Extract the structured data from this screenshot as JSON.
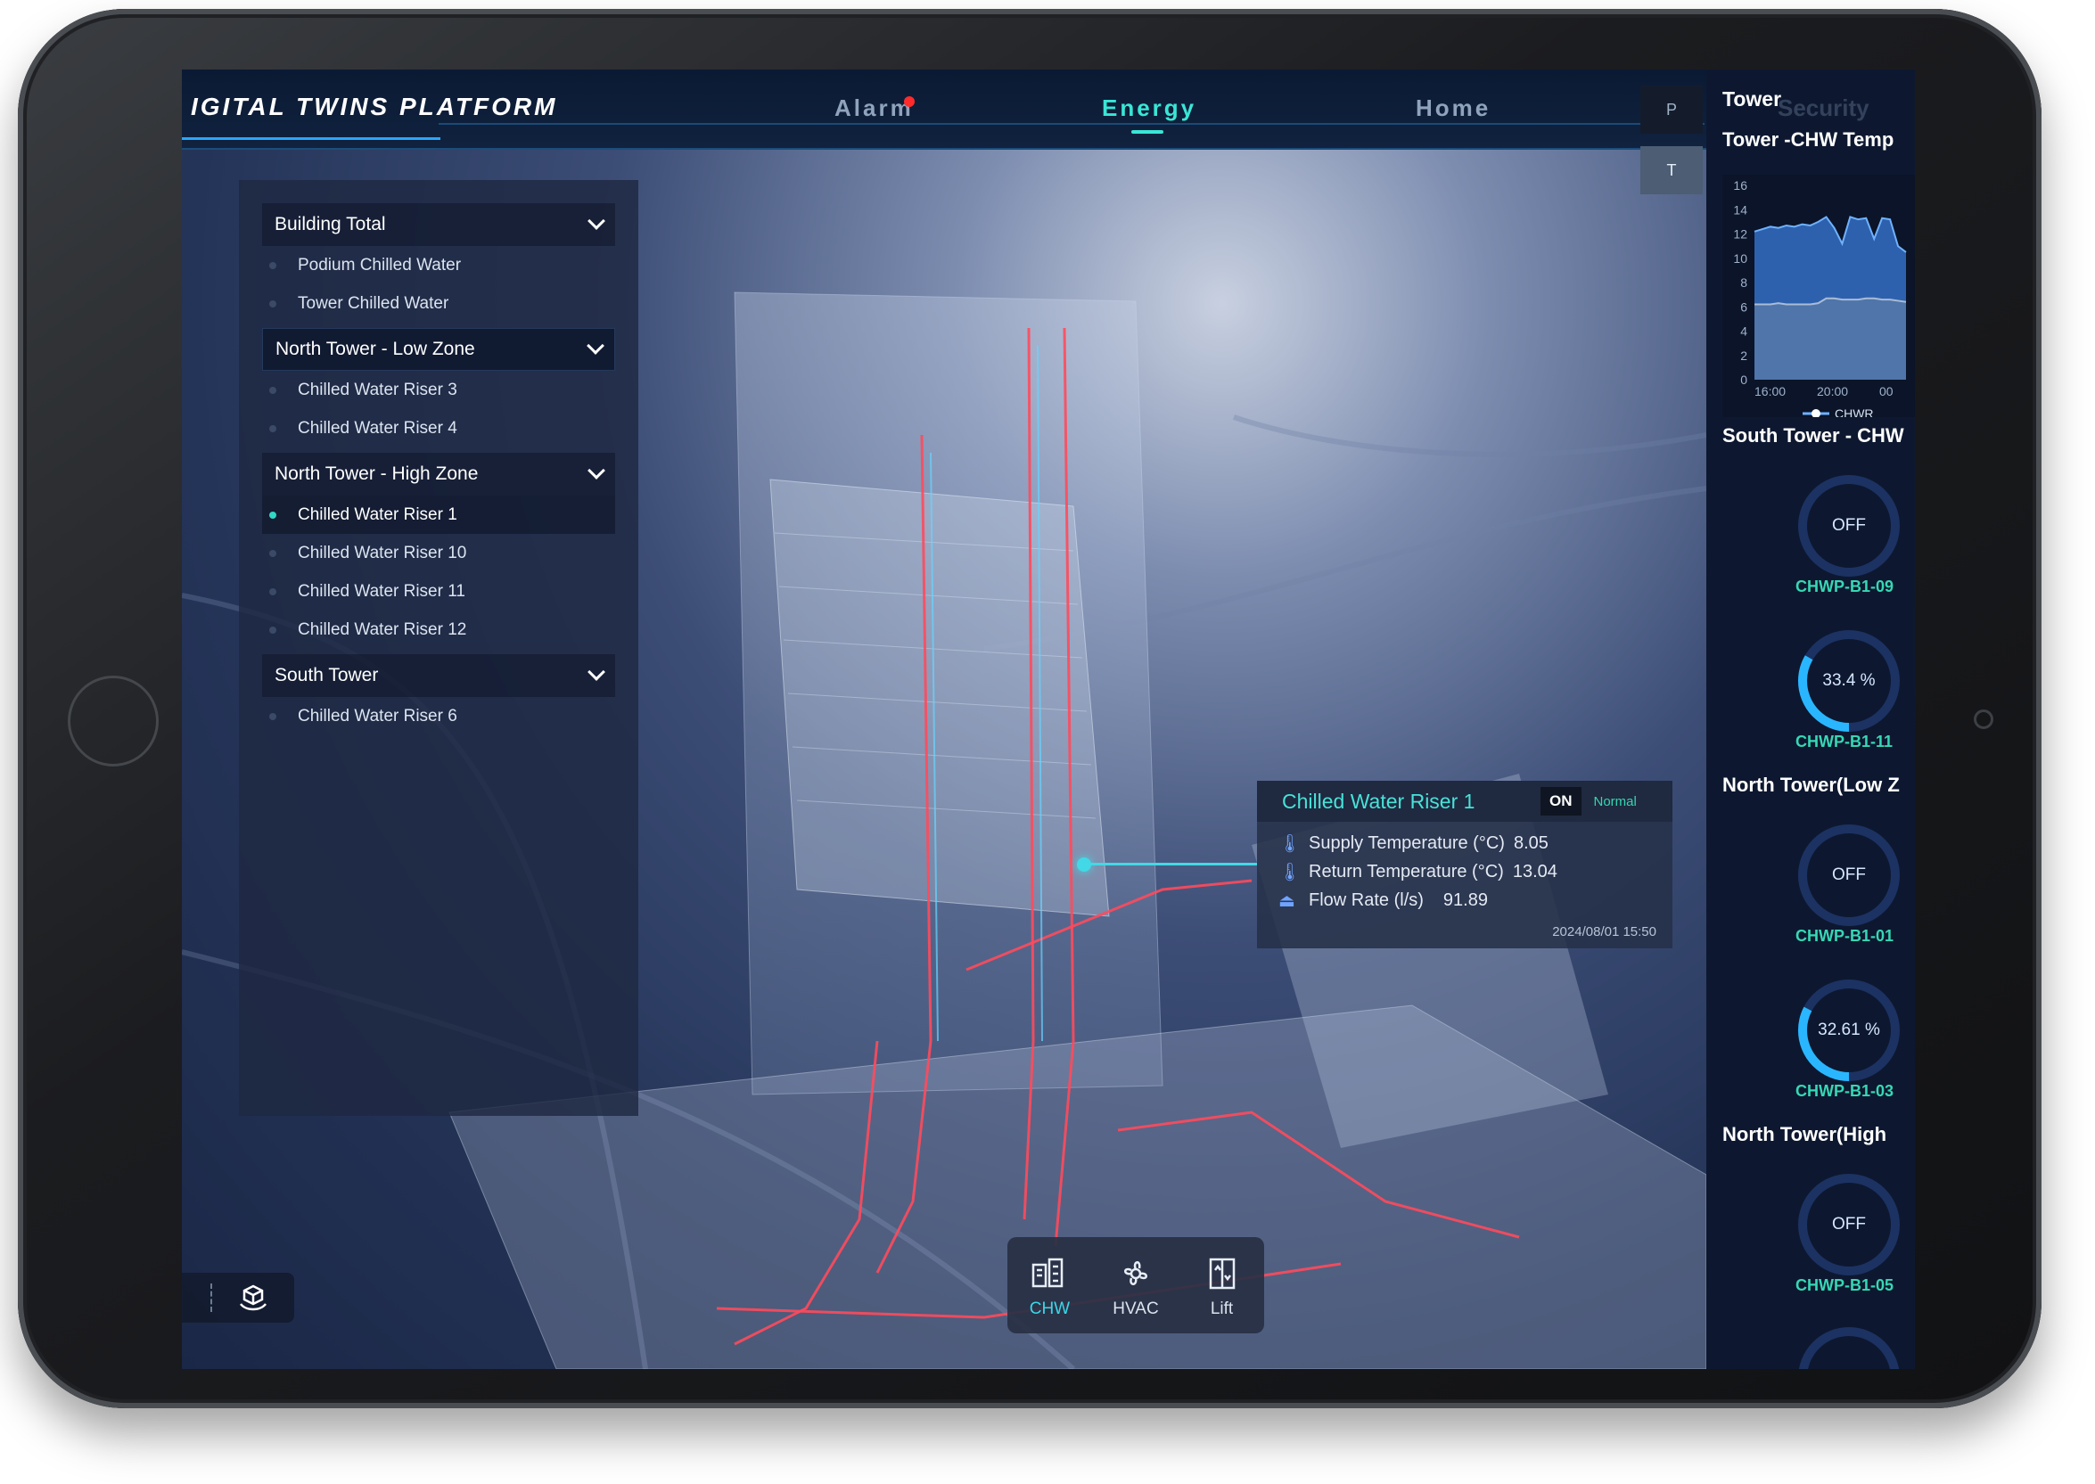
{
  "header": {
    "brand": "IGITAL TWINS PLATFORM",
    "nav": [
      {
        "label": "Alarm",
        "active": false
      },
      {
        "label": "Energy",
        "active": true
      },
      {
        "label": "Home",
        "active": false
      }
    ],
    "side_tabs": [
      "P",
      "T"
    ]
  },
  "tree": {
    "groups": [
      {
        "label": "Building Total",
        "items": [
          {
            "label": "Podium Chilled Water",
            "active": false
          },
          {
            "label": "Tower Chilled Water",
            "active": false
          }
        ]
      },
      {
        "label": "North Tower - Low Zone",
        "items": [
          {
            "label": "Chilled Water Riser 3",
            "active": false
          },
          {
            "label": "Chilled Water Riser 4",
            "active": false
          }
        ]
      },
      {
        "label": "North Tower - High Zone",
        "items": [
          {
            "label": "Chilled Water Riser 1",
            "active": true
          },
          {
            "label": "Chilled Water Riser 10",
            "active": false
          },
          {
            "label": "Chilled Water Riser 11",
            "active": false
          },
          {
            "label": "Chilled Water Riser 12",
            "active": false
          }
        ]
      },
      {
        "label": "South Tower",
        "items": [
          {
            "label": "Chilled Water Riser 6",
            "active": false
          }
        ]
      }
    ]
  },
  "popup": {
    "title": "Chilled Water Riser 1",
    "state": "ON",
    "status": "Normal",
    "rows": [
      {
        "icon": "thermometer-icon",
        "label": "Supply Temperature (°C)",
        "value": "8.05"
      },
      {
        "icon": "thermometer-icon",
        "label": "Return Temperature (°C)",
        "value": "13.04"
      },
      {
        "icon": "flow-icon",
        "label": "Flow Rate (l/s)",
        "value": "91.89"
      }
    ],
    "timestamp": "2024/08/01 15:50"
  },
  "toolbar": {
    "tools": [
      {
        "label": "CHW",
        "icon": "building-icon",
        "active": true
      },
      {
        "label": "HVAC",
        "icon": "fan-icon",
        "active": false
      },
      {
        "label": "Lift",
        "icon": "lift-icon",
        "active": false
      }
    ]
  },
  "right_panel": {
    "title": "Tower",
    "ghost_text": "Security",
    "chart_title": "Tower -CHW Temp",
    "sections": [
      {
        "title": "South Tower - CHW",
        "gauges": [
          {
            "label": "CHWP-B1-09",
            "text": "OFF",
            "percent": 0
          },
          {
            "label": "CHWP-B1-11",
            "text": "33.4 %",
            "percent": 33.4
          }
        ]
      },
      {
        "title": "North Tower(Low Z",
        "gauges": [
          {
            "label": "CHWP-B1-01",
            "text": "OFF",
            "percent": 0
          },
          {
            "label": "CHWP-B1-03",
            "text": "32.61 %",
            "percent": 32.61
          }
        ]
      },
      {
        "title": "North Tower(High",
        "gauges": [
          {
            "label": "CHWP-B1-05",
            "text": "OFF",
            "percent": 0
          }
        ]
      }
    ],
    "accent_color": "#37d7b4",
    "gauge_color": "#2ab6ff"
  },
  "chart_data": {
    "type": "area",
    "title": "Tower -CHW Temp",
    "x_ticks": [
      "16:00",
      "20:00",
      "00"
    ],
    "y_ticks": [
      0,
      2,
      4,
      6,
      8,
      10,
      12,
      14,
      16
    ],
    "ylim": [
      0,
      16
    ],
    "legend": "CHWR",
    "series": [
      {
        "name": "CHWR",
        "values": [
          12.2,
          12.4,
          12.6,
          12.5,
          12.7,
          12.6,
          12.8,
          12.7,
          13.0,
          13.4,
          12.5,
          11.2,
          13.4,
          13.2,
          13.3,
          11.6,
          13.3,
          13.2,
          11.0,
          10.5
        ]
      },
      {
        "name": "",
        "values": [
          6.2,
          6.2,
          6.2,
          6.3,
          6.2,
          6.2,
          6.2,
          6.2,
          6.3,
          6.7,
          6.7,
          6.6,
          6.6,
          6.6,
          6.7,
          6.7,
          6.6,
          6.6,
          6.5,
          6.4
        ]
      }
    ]
  }
}
